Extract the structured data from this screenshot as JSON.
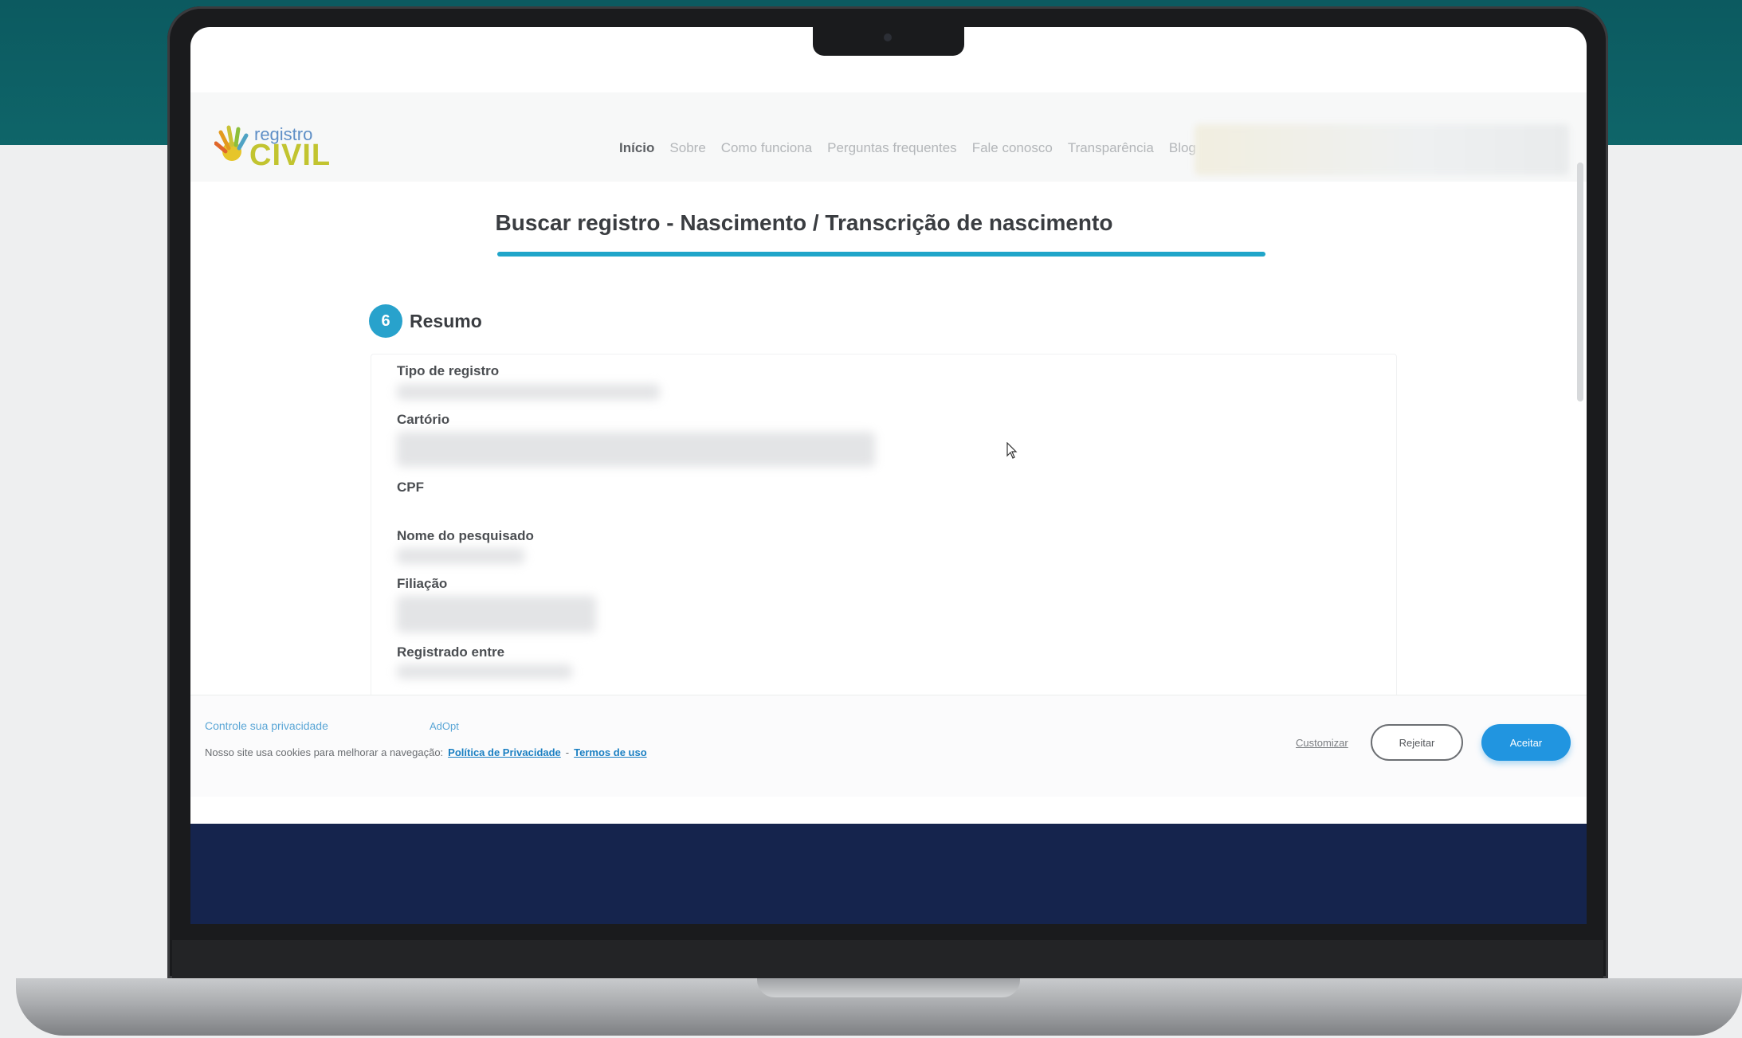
{
  "colors": {
    "teal_background": "#0e6569",
    "accent": "#20a5c9",
    "footer": "#15244d",
    "accept_button": "#2195e0"
  },
  "logo": {
    "top": "registro",
    "bottom": "CIVIL"
  },
  "nav": {
    "items": [
      {
        "label": "Início"
      },
      {
        "label": "Sobre"
      },
      {
        "label": "Como funciona"
      },
      {
        "label": "Perguntas frequentes"
      },
      {
        "label": "Fale conosco"
      },
      {
        "label": "Transparência"
      },
      {
        "label": "Blog"
      }
    ]
  },
  "page": {
    "title": "Buscar registro - Nascimento / Transcrição de nascimento",
    "step_number": "6",
    "step_label": "Resumo"
  },
  "summary": {
    "tipo_label": "Tipo de registro",
    "cartorio_label": "Cartório",
    "cpf_label": "CPF",
    "cpf_value": "-",
    "nome_label": "Nome do pesquisado",
    "filiacao_label": "Filiação",
    "registrado_label": "Registrado entre"
  },
  "cookie": {
    "title": "Controle sua privacidade",
    "brand": "AdOpt",
    "text": "Nosso site usa cookies para melhorar a navegação:",
    "privacy_link": "Política de Privacidade",
    "separator": "-",
    "terms_link": "Termos de uso",
    "customize_label": "Customizar",
    "reject_label": "Rejeitar",
    "accept_label": "Aceitar"
  }
}
